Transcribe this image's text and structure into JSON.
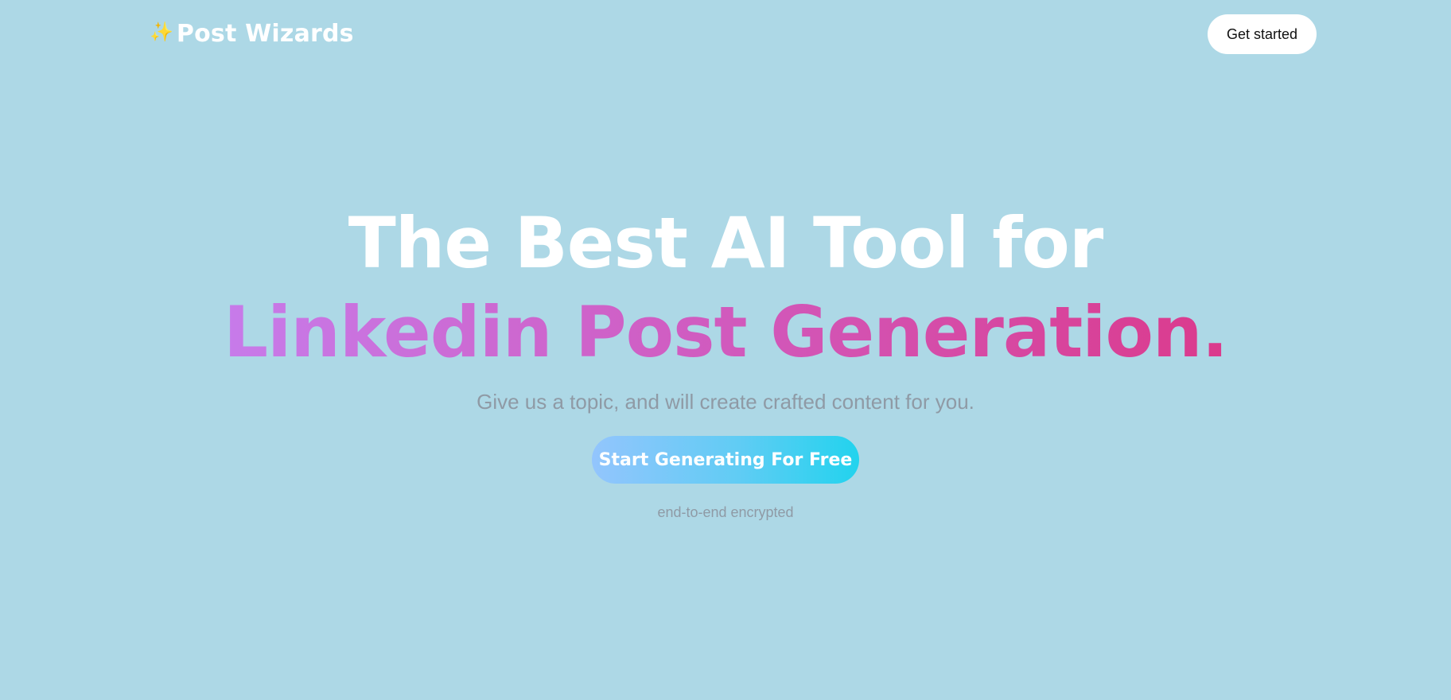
{
  "header": {
    "brand_icon": "✨",
    "brand_name": "Post Wizards",
    "get_started_label": "Get started"
  },
  "hero": {
    "headline_line1": "The Best AI Tool for",
    "headline_line2": "Linkedin Post Generation.",
    "subtitle": "Give us a topic, and will create crafted content for you.",
    "cta_label": "Start Generating For Free",
    "security_note": "end-to-end encrypted"
  },
  "colors": {
    "background": "#add8e6",
    "headline_gradient_start": "#c77bea",
    "headline_gradient_end": "#db3a8c",
    "cta_gradient_start": "#93c5fd",
    "cta_gradient_end": "#22d3ee"
  }
}
